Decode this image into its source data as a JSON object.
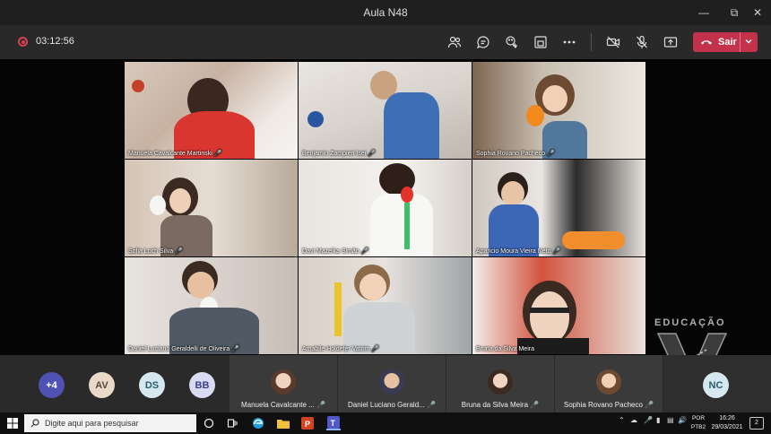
{
  "window": {
    "title": "Aula N48"
  },
  "toolbar": {
    "timer": "03:12:56",
    "leave_label": "Sair",
    "icons": [
      "people-icon",
      "chat-icon",
      "reactions-icon",
      "share-tray-icon",
      "more-icon",
      "camera-off-icon",
      "mic-off-icon",
      "share-icon"
    ]
  },
  "videos": [
    {
      "name": "Manuela Cavalcante Martinski"
    },
    {
      "name": "Benjamin Zampieri Isei"
    },
    {
      "name": "Sophia Rovano Pacheco"
    },
    {
      "name": "Sofia Loch Silva"
    },
    {
      "name": "Davi Mazeika Simão"
    },
    {
      "name": "Aparicio Moura Vieira Neto"
    },
    {
      "name": "Daniel Luciano Geraldelli de Oliveira"
    },
    {
      "name": "Amabile Holdefer Vatrim"
    },
    {
      "name": "Bruna da Silva Meira"
    }
  ],
  "watermark": {
    "text": "EDUCAÇÃO"
  },
  "roster": {
    "overflow": "+4",
    "initials": [
      "AV",
      "DS",
      "BB"
    ],
    "cards": [
      {
        "name": "Manuela Cavalcante ..."
      },
      {
        "name": "Daniel Luciano Gerald..."
      },
      {
        "name": "Bruna da Silva Meira"
      },
      {
        "name": "Sophia Rovano Pacheco"
      }
    ],
    "last_initials": "NC",
    "colors": {
      "plus": "#4f52b2",
      "AV": "#e8d9c8",
      "DS": "#d6e8ef",
      "BB": "#d9dbf2",
      "NC": "#d6e8ef"
    }
  },
  "taskbar": {
    "search_placeholder": "Digite aqui para pesquisar",
    "lang_top": "POR",
    "lang_bottom": "PTB2",
    "time": "16:26",
    "date": "29/03/2021",
    "notifications": "2"
  }
}
